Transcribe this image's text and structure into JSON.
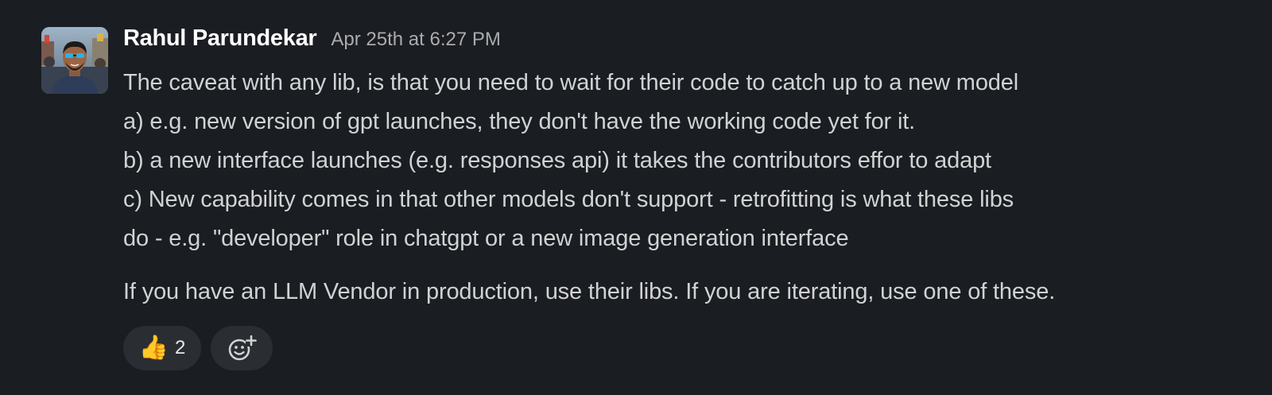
{
  "message": {
    "sender": "Rahul Parundekar",
    "timestamp": "Apr 25th at 6:27 PM",
    "lines": [
      "The caveat with any lib, is that you need to wait for their code to catch up to a new model",
      "a) e.g. new version of gpt launches, they don't have the working code yet for it.",
      "b) a new interface launches (e.g. responses api) it takes the contributors effor to adapt",
      "c) New capability comes in that other models don't support - retrofitting is what these libs",
      "do - e.g. \"developer\" role in chatgpt or a new image generation interface"
    ],
    "closing": "If you have an LLM Vendor in production, use their libs. If you are iterating, use one of these.",
    "avatar_icon": "user-avatar-photo"
  },
  "reactions": [
    {
      "emoji": "👍",
      "count": "2",
      "icon": "thumbs-up-icon"
    }
  ],
  "add_reaction_icon": "add-reaction-icon",
  "colors": {
    "background": "#1a1d21",
    "text": "#d1d2d3",
    "sender": "#ffffff",
    "timestamp": "#ababad",
    "pill": "#2a2d31"
  }
}
